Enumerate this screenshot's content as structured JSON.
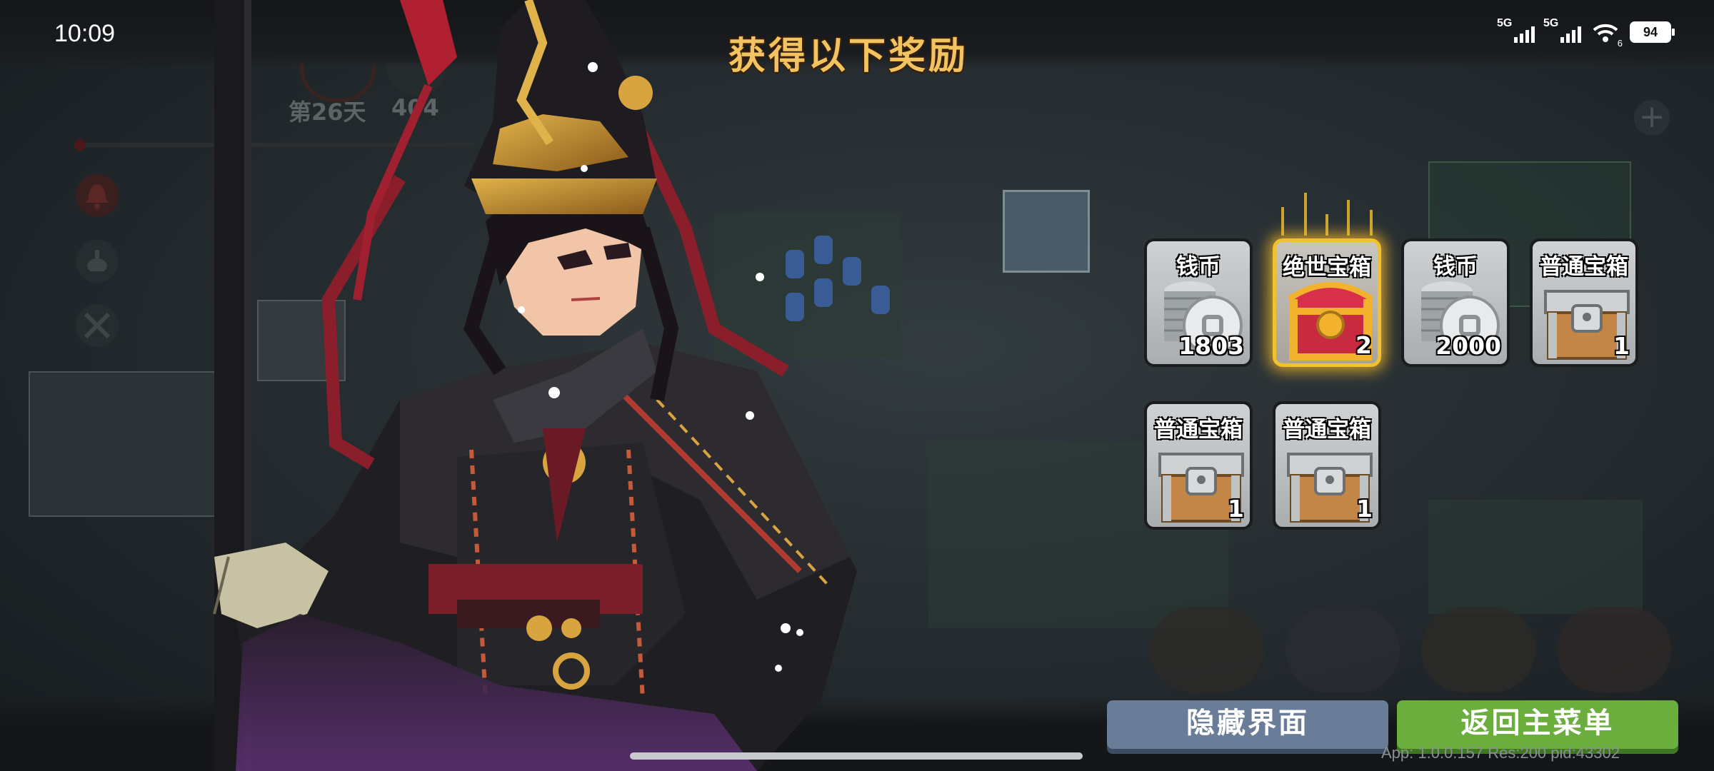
{
  "status_bar": {
    "time": "10:09",
    "signal_1_label": "5G",
    "signal_2_label": "5G",
    "wifi_sub": "6",
    "battery": "94"
  },
  "header": {
    "title": "获得以下奖励"
  },
  "game_hud": {
    "day": "第26天",
    "score": "404"
  },
  "rewards": [
    {
      "name": "钱币",
      "count": "1803",
      "icon": "coin-stack-icon",
      "highlight": false
    },
    {
      "name": "绝世宝箱",
      "count": "2",
      "icon": "legendary-chest-icon",
      "highlight": true
    },
    {
      "name": "钱币",
      "count": "2000",
      "icon": "coin-stack-icon",
      "highlight": false
    },
    {
      "name": "普通宝箱",
      "count": "1",
      "icon": "common-chest-icon",
      "highlight": false
    },
    {
      "name": "普通宝箱",
      "count": "1",
      "icon": "common-chest-icon",
      "highlight": false
    },
    {
      "name": "普通宝箱",
      "count": "1",
      "icon": "common-chest-icon",
      "highlight": false
    }
  ],
  "buttons": {
    "hide": "隐藏界面",
    "main_menu": "返回主菜单"
  },
  "footer": {
    "version": "App: 1.0.0.157 Res:200 pid:43302"
  },
  "colors": {
    "title": "#f2c461",
    "hide_button": "#6a7d98",
    "menu_button": "#6cae3e",
    "gold_frame": "#f2c12e"
  }
}
